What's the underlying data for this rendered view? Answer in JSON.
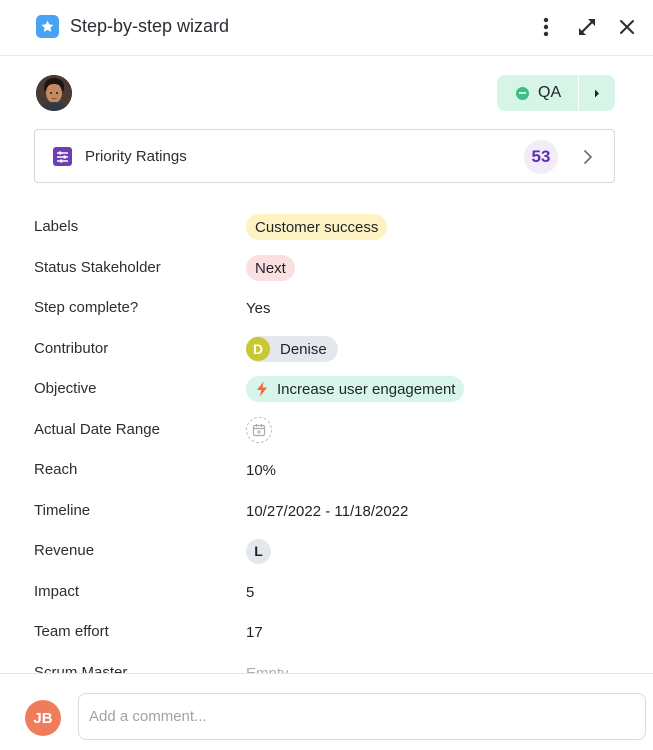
{
  "header": {
    "title": "Step-by-step wizard",
    "icons": {
      "app": "star-icon",
      "more": "kebab-menu-icon",
      "expand": "collapse-expand-icon",
      "close": "close-icon"
    }
  },
  "status": {
    "label": "QA",
    "color": "#3bbf84",
    "background": "#d6f5e6"
  },
  "priority": {
    "label": "Priority Ratings",
    "count": "53",
    "icon": "sliders-icon"
  },
  "fields": [
    {
      "label": "Labels",
      "value": "Customer success"
    },
    {
      "label": "Status Stakeholder",
      "value": "Next"
    },
    {
      "label": "Step complete?",
      "value": "Yes"
    },
    {
      "label": "Contributor",
      "value": "Denise",
      "avatar": "D"
    },
    {
      "label": "Objective",
      "value": "Increase user engagement"
    },
    {
      "label": "Actual Date Range",
      "value": ""
    },
    {
      "label": "Reach",
      "value": "10%"
    },
    {
      "label": "Timeline",
      "value": "10/27/2022 - 11/18/2022"
    },
    {
      "label": "Revenue",
      "value": "L"
    },
    {
      "label": "Impact",
      "value": "5"
    },
    {
      "label": "Team effort",
      "value": "17"
    },
    {
      "label": "Scrum Master",
      "value": "Empty"
    }
  ],
  "footer": {
    "initials": "JB",
    "placeholder": "Add a comment..."
  }
}
